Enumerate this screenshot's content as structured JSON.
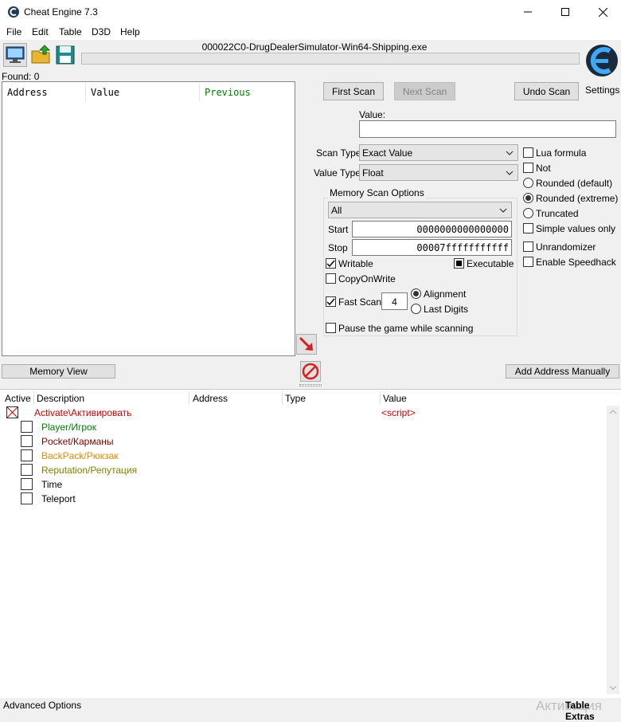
{
  "window": {
    "title": "Cheat Engine 7.3"
  },
  "menu": {
    "file": "File",
    "edit": "Edit",
    "table": "Table",
    "d3d": "D3D",
    "help": "Help"
  },
  "process": {
    "name": "000022C0-DrugDealerSimulator-Win64-Shipping.exe"
  },
  "logo": {
    "settings_label": "Settings"
  },
  "results": {
    "found_label": "Found: 0",
    "columns": {
      "address": "Address",
      "value": "Value",
      "previous": "Previous"
    }
  },
  "scan": {
    "first_scan": "First Scan",
    "next_scan": "Next Scan",
    "undo_scan": "Undo Scan",
    "value_label": "Value:",
    "value": "",
    "scan_type_label": "Scan Type",
    "scan_type": "Exact Value",
    "value_type_label": "Value Type",
    "value_type": "Float"
  },
  "memory_options": {
    "title": "Memory Scan Options",
    "region": "All",
    "start_label": "Start",
    "start": "0000000000000000",
    "stop_label": "Stop",
    "stop": "00007fffffffffff",
    "writable": "Writable",
    "executable": "Executable",
    "copy_on_write": "CopyOnWrite",
    "fast_scan": "Fast Scan",
    "fast_scan_value": "4",
    "alignment": "Alignment",
    "last_digits": "Last Digits",
    "pause_game": "Pause the game while scanning"
  },
  "options": {
    "lua_formula": "Lua formula",
    "not": "Not",
    "rounded_default": "Rounded (default)",
    "rounded_extreme": "Rounded (extreme)",
    "truncated": "Truncated",
    "simple_values": "Simple values only",
    "unrandomizer": "Unrandomizer",
    "speedhack": "Enable Speedhack"
  },
  "actions": {
    "memory_view": "Memory View",
    "add_address": "Add Address Manually"
  },
  "table": {
    "columns": {
      "active": "Active",
      "description": "Description",
      "address": "Address",
      "type": "Type",
      "value": "Value"
    },
    "rows": [
      {
        "description": "Activate\\Активировать",
        "value": "<script>",
        "color": "#cc0000"
      },
      {
        "description": "Player/Игрок",
        "color": "#008000"
      },
      {
        "description": "Pocket/Карманы",
        "color": "#800000"
      },
      {
        "description": "BackPack/Рюкзак",
        "color": "#e08a00"
      },
      {
        "description": "Reputation/Репутация",
        "color": "#808000"
      },
      {
        "description": "Time",
        "color": "#000000"
      },
      {
        "description": "Teleport",
        "color": "#000000"
      }
    ]
  },
  "status": {
    "advanced_options": "Advanced Options",
    "table_extras": "Table Extras",
    "watermark": "Активация"
  },
  "colors": {
    "disabled_text": "#838383",
    "previous_col": "#008000"
  }
}
